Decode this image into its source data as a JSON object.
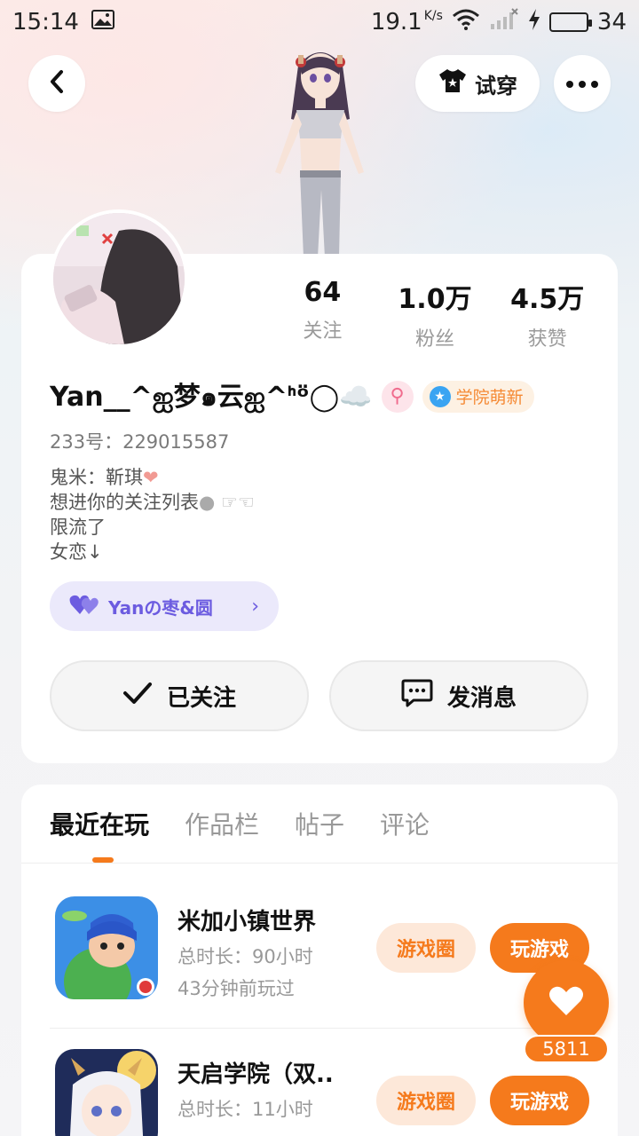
{
  "status_bar": {
    "time": "15:14",
    "net_speed": "19.1",
    "net_unit": "K/s",
    "battery": "34",
    "battery_color": "#2fb52f"
  },
  "header": {
    "back_icon": "chevron-left-icon",
    "try_on_label": "试穿",
    "more_icon": "more-dots-icon"
  },
  "profile": {
    "stats": [
      {
        "value": "64",
        "label": "关注"
      },
      {
        "value": "1.0万",
        "label": "粉丝"
      },
      {
        "value": "4.5万",
        "label": "获赞"
      }
    ],
    "username": "Yan__^ஐ梦๑云ஐ^ᑋᵒ̈◯☁️",
    "gender_symbol": "⚲",
    "level_badge": "学院萌新",
    "uid": "233号：229015587",
    "bio": [
      "鬼米：靳琪",
      "想进你的关注列表",
      "限流了",
      "女恋↓"
    ],
    "group": {
      "label": "Yanの枣&圆"
    },
    "follow_label": "已关注",
    "message_label": "发消息"
  },
  "tabs": [
    {
      "label": "最近在玩",
      "active": true
    },
    {
      "label": "作品栏",
      "active": false
    },
    {
      "label": "帖子",
      "active": false
    },
    {
      "label": "评论",
      "active": false
    }
  ],
  "games": [
    {
      "title": "米加小镇世界",
      "playtime": "总时长：90小时",
      "last_played": "43分钟前玩过",
      "circle_label": "游戏圈",
      "play_label": "玩游戏"
    },
    {
      "title": "天启学院（双..",
      "playtime": "总时长：11小时",
      "last_played": "",
      "circle_label": "游戏圈",
      "play_label": "玩游戏"
    }
  ],
  "like_fab": {
    "count": "5811"
  },
  "colors": {
    "accent": "#f57a1c",
    "group_purple": "#6c5ce0"
  }
}
